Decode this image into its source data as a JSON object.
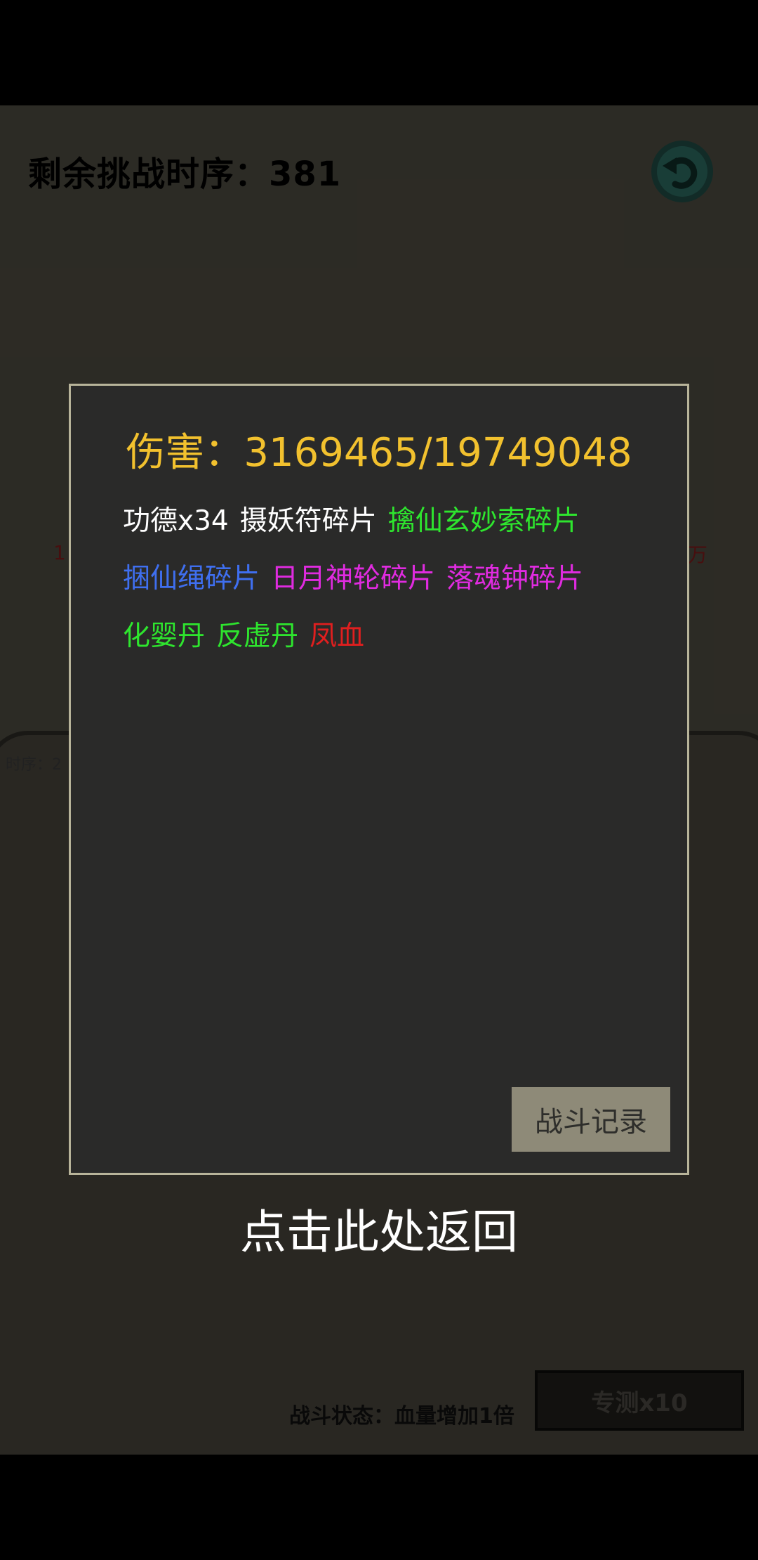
{
  "header": {
    "challenge_label": "剩余挑战时序：381"
  },
  "background": {
    "side_text": "时序：2",
    "left_mark": "1",
    "right_mark": "万"
  },
  "footer": {
    "status_label": "战斗状态：血量增加1倍",
    "pk_button": "专测x10"
  },
  "dialog": {
    "damage": "伤害：3169465/19749048",
    "rewards": [
      [
        {
          "text": "功德x34",
          "color": "#ffffff"
        },
        {
          "text": "摄妖符碎片",
          "color": "#ffffff"
        },
        {
          "text": "擒仙玄妙索碎片",
          "color": "#2ee52e"
        }
      ],
      [
        {
          "text": "捆仙绳碎片",
          "color": "#3f6ff0"
        },
        {
          "text": "日月神轮碎片",
          "color": "#e02be0"
        },
        {
          "text": "落魂钟碎片",
          "color": "#e02be0"
        }
      ],
      [
        {
          "text": "化婴丹",
          "color": "#2ee52e"
        },
        {
          "text": "反虚丹",
          "color": "#2ee52e"
        },
        {
          "text": "凤血",
          "color": "#e01f1f"
        }
      ]
    ],
    "battle_log_button": "战斗记录"
  },
  "return_hint": "点击此处返回",
  "colors": {
    "damage": "#f2c12e",
    "dialog_bg": "#2a2a29",
    "dialog_border": "#b8b49a"
  }
}
